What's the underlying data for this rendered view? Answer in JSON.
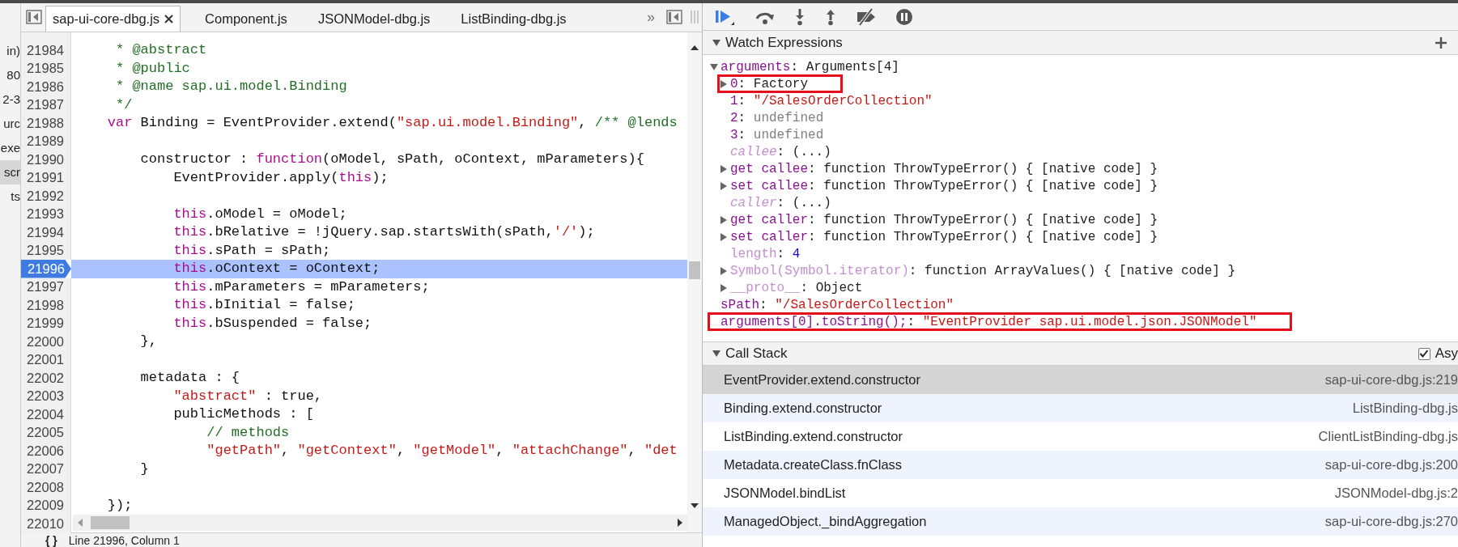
{
  "navigator": {
    "items": [
      {
        "label": "in)",
        "selected": false
      },
      {
        "label": "80",
        "selected": false
      },
      {
        "label": "2-3",
        "selected": false
      },
      {
        "label": "urc",
        "selected": false
      },
      {
        "label": "exe",
        "selected": false
      },
      {
        "label": "scr",
        "selected": true
      },
      {
        "label": "ts",
        "selected": false
      }
    ]
  },
  "editor": {
    "tabs": [
      {
        "label": "sap-ui-core-dbg.js",
        "selected": true
      },
      {
        "label": "Component.js",
        "selected": false
      },
      {
        "label": "JSONModel-dbg.js",
        "selected": false
      },
      {
        "label": "ListBinding-dbg.js",
        "selected": false
      }
    ],
    "overflow": "»",
    "lines": [
      {
        "number": "21984",
        "selected": false,
        "segments": [
          {
            "text": "     * @abstract",
            "kind": "comment"
          }
        ]
      },
      {
        "number": "21985",
        "selected": false,
        "segments": [
          {
            "text": "     * @public",
            "kind": "comment"
          }
        ]
      },
      {
        "number": "21986",
        "selected": false,
        "segments": [
          {
            "text": "     * @name sap.ui.model.Binding",
            "kind": "comment"
          }
        ]
      },
      {
        "number": "21987",
        "selected": false,
        "segments": [
          {
            "text": "     */",
            "kind": "comment"
          }
        ]
      },
      {
        "number": "21988",
        "selected": false,
        "segments": [
          {
            "text": "    var",
            "kind": "keyword"
          },
          {
            "text": " Binding = EventProvider.extend(",
            "kind": "plain"
          },
          {
            "text": "\"sap.ui.model.Binding\"",
            "kind": "string"
          },
          {
            "text": ", ",
            "kind": "plain"
          },
          {
            "text": "/** @lends",
            "kind": "comment"
          }
        ]
      },
      {
        "number": "21989",
        "selected": false
      },
      {
        "number": "21990",
        "selected": false,
        "segments": [
          {
            "text": "        constructor : ",
            "kind": "plain"
          },
          {
            "text": "function",
            "kind": "keyword"
          },
          {
            "text": "(oModel, sPath, oContext, mParameters){",
            "kind": "plain"
          }
        ]
      },
      {
        "number": "21991",
        "selected": false,
        "segments": [
          {
            "text": "            EventProvider.apply(",
            "kind": "plain"
          },
          {
            "text": "this",
            "kind": "keyword"
          },
          {
            "text": ");",
            "kind": "plain"
          }
        ]
      },
      {
        "number": "21992",
        "selected": false
      },
      {
        "number": "21993",
        "selected": false,
        "segments": [
          {
            "text": "            this",
            "kind": "keyword"
          },
          {
            "text": ".oModel = oModel;",
            "kind": "plain"
          }
        ]
      },
      {
        "number": "21994",
        "selected": false,
        "segments": [
          {
            "text": "            this",
            "kind": "keyword"
          },
          {
            "text": ".bRelative = !jQuery.sap.startsWith(sPath,",
            "kind": "plain"
          },
          {
            "text": "'/'",
            "kind": "string"
          },
          {
            "text": ");",
            "kind": "plain"
          }
        ]
      },
      {
        "number": "21995",
        "selected": false,
        "segments": [
          {
            "text": "            this",
            "kind": "keyword"
          },
          {
            "text": ".sPath = sPath;",
            "kind": "plain"
          }
        ]
      },
      {
        "number": "21996",
        "selected": true,
        "segments": [
          {
            "text": "            this",
            "kind": "keyword"
          },
          {
            "text": ".oContext = oContext;",
            "kind": "plain"
          }
        ]
      },
      {
        "number": "21997",
        "selected": false,
        "segments": [
          {
            "text": "            this",
            "kind": "keyword"
          },
          {
            "text": ".mParameters = mParameters;",
            "kind": "plain"
          }
        ]
      },
      {
        "number": "21998",
        "selected": false,
        "segments": [
          {
            "text": "            this",
            "kind": "keyword"
          },
          {
            "text": ".bInitial = false;",
            "kind": "plain"
          }
        ]
      },
      {
        "number": "21999",
        "selected": false,
        "segments": [
          {
            "text": "            this",
            "kind": "keyword"
          },
          {
            "text": ".bSuspended = false;",
            "kind": "plain"
          }
        ]
      },
      {
        "number": "22000",
        "selected": false,
        "segments": [
          {
            "text": "        },",
            "kind": "plain"
          }
        ]
      },
      {
        "number": "22001",
        "selected": false
      },
      {
        "number": "22002",
        "selected": false,
        "segments": [
          {
            "text": "        metadata : {",
            "kind": "plain"
          }
        ]
      },
      {
        "number": "22003",
        "selected": false,
        "segments": [
          {
            "text": "            \"abstract\"",
            "kind": "string"
          },
          {
            "text": " : true,",
            "kind": "plain"
          }
        ]
      },
      {
        "number": "22004",
        "selected": false,
        "segments": [
          {
            "text": "            publicMethods : [",
            "kind": "plain"
          }
        ]
      },
      {
        "number": "22005",
        "selected": false,
        "segments": [
          {
            "text": "                // methods",
            "kind": "comment"
          }
        ]
      },
      {
        "number": "22006",
        "selected": false,
        "segments": [
          {
            "text": "                \"getPath\"",
            "kind": "string"
          },
          {
            "text": ", ",
            "kind": "plain"
          },
          {
            "text": "\"getContext\"",
            "kind": "string"
          },
          {
            "text": ", ",
            "kind": "plain"
          },
          {
            "text": "\"getModel\"",
            "kind": "string"
          },
          {
            "text": ", ",
            "kind": "plain"
          },
          {
            "text": "\"attachChange\"",
            "kind": "string"
          },
          {
            "text": ", ",
            "kind": "plain"
          },
          {
            "text": "\"det",
            "kind": "string"
          }
        ]
      },
      {
        "number": "22007",
        "selected": false,
        "segments": [
          {
            "text": "        }",
            "kind": "plain"
          }
        ]
      },
      {
        "number": "22008",
        "selected": false
      },
      {
        "number": "22009",
        "selected": false,
        "segments": [
          {
            "text": "    });",
            "kind": "plain"
          }
        ]
      },
      {
        "number": "22010",
        "selected": false
      }
    ],
    "status": {
      "braces": "{ }",
      "position": "Line 21996, Column 1"
    }
  },
  "debugger": {
    "watch": {
      "title": "Watch Expressions",
      "expanded": true,
      "items": [
        {
          "segments": [
            {
              "text": "arguments",
              "kind": "own"
            },
            {
              "text": ": ",
              "kind": "plain"
            },
            {
              "text": "Arguments[4]",
              "kind": "plain"
            }
          ],
          "expanded": true,
          "children": [
            {
              "segments": [
                {
                  "text": "0",
                  "kind": "own"
                },
                {
                  "text": ": ",
                  "kind": "plain"
                },
                {
                  "text": "Factory",
                  "kind": "plain"
                }
              ],
              "expanded": false,
              "highlighted": true
            },
            {
              "segments": [
                {
                  "text": "1",
                  "kind": "own"
                },
                {
                  "text": ": ",
                  "kind": "plain"
                },
                {
                  "text": "\"/SalesOrderCollection\"",
                  "kind": "string"
                }
              ]
            },
            {
              "segments": [
                {
                  "text": "2",
                  "kind": "own"
                },
                {
                  "text": ": ",
                  "kind": "plain"
                },
                {
                  "text": "undefined",
                  "kind": "undefined"
                }
              ]
            },
            {
              "segments": [
                {
                  "text": "3",
                  "kind": "own"
                },
                {
                  "text": ": ",
                  "kind": "plain"
                },
                {
                  "text": "undefined",
                  "kind": "undefined"
                }
              ]
            },
            {
              "segments": [
                {
                  "text": "callee",
                  "kind": "accessor"
                },
                {
                  "text": ": ",
                  "kind": "plain"
                },
                {
                  "text": "(...)",
                  "kind": "plain"
                }
              ]
            },
            {
              "segments": [
                {
                  "text": "get callee",
                  "kind": "own"
                },
                {
                  "text": ": ",
                  "kind": "plain"
                },
                {
                  "text": "function ThrowTypeError() { [native code] }",
                  "kind": "plain"
                }
              ],
              "expanded": false
            },
            {
              "segments": [
                {
                  "text": "set callee",
                  "kind": "own"
                },
                {
                  "text": ": ",
                  "kind": "plain"
                },
                {
                  "text": "function ThrowTypeError() { [native code] }",
                  "kind": "plain"
                }
              ],
              "expanded": false
            },
            {
              "segments": [
                {
                  "text": "caller",
                  "kind": "accessor"
                },
                {
                  "text": ": ",
                  "kind": "plain"
                },
                {
                  "text": "(...)",
                  "kind": "plain"
                }
              ]
            },
            {
              "segments": [
                {
                  "text": "get caller",
                  "kind": "own"
                },
                {
                  "text": ": ",
                  "kind": "plain"
                },
                {
                  "text": "function ThrowTypeError() { [native code] }",
                  "kind": "plain"
                }
              ],
              "expanded": false
            },
            {
              "segments": [
                {
                  "text": "set caller",
                  "kind": "own"
                },
                {
                  "text": ": ",
                  "kind": "plain"
                },
                {
                  "text": "function ThrowTypeError() { [native code] }",
                  "kind": "plain"
                }
              ],
              "expanded": false
            },
            {
              "segments": [
                {
                  "text": "length",
                  "kind": "hidden"
                },
                {
                  "text": ": ",
                  "kind": "plain"
                },
                {
                  "text": "4",
                  "kind": "number"
                }
              ]
            },
            {
              "segments": [
                {
                  "text": "Symbol(Symbol.iterator)",
                  "kind": "hidden"
                },
                {
                  "text": ": ",
                  "kind": "plain"
                },
                {
                  "text": "function ArrayValues() { [native code] }",
                  "kind": "plain"
                }
              ],
              "expanded": false
            },
            {
              "segments": [
                {
                  "text": "__proto__",
                  "kind": "hidden"
                },
                {
                  "text": ": ",
                  "kind": "plain"
                },
                {
                  "text": "Object",
                  "kind": "plain"
                }
              ],
              "expanded": false
            }
          ]
        },
        {
          "segments": [
            {
              "text": "sPath",
              "kind": "own"
            },
            {
              "text": ": ",
              "kind": "plain"
            },
            {
              "text": "\"/SalesOrderCollection\"",
              "kind": "string"
            }
          ]
        },
        {
          "segments": [
            {
              "text": "arguments[0].toString();",
              "kind": "own"
            },
            {
              "text": ": ",
              "kind": "plain"
            },
            {
              "text": "\"EventProvider sap.ui.model.json.JSONModel\"",
              "kind": "string"
            }
          ],
          "highlighted": true
        }
      ]
    },
    "call_stack": {
      "title": "Call Stack",
      "expanded": true,
      "async": {
        "label": "Asy",
        "checked": true
      },
      "frames": [
        {
          "function": "EventProvider.extend.constructor",
          "location": "sap-ui-core-dbg.js:219",
          "selected": true
        },
        {
          "function": "Binding.extend.constructor",
          "location": "ListBinding-dbg.js",
          "selected": false
        },
        {
          "function": "ListBinding.extend.constructor",
          "location": "ClientListBinding-dbg.js",
          "selected": false
        },
        {
          "function": "Metadata.createClass.fnClass",
          "location": "sap-ui-core-dbg.js:200",
          "selected": false
        },
        {
          "function": "JSONModel.bindList",
          "location": "JSONModel-dbg.js:2",
          "selected": false
        },
        {
          "function": "ManagedObject._bindAggregation",
          "location": "sap-ui-core-dbg.js:270",
          "selected": false
        }
      ]
    }
  }
}
